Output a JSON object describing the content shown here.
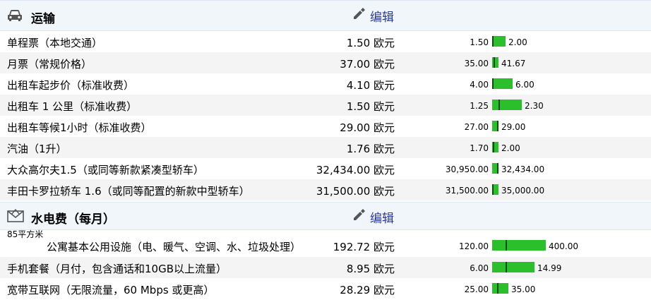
{
  "sections": [
    {
      "title": "运输",
      "icon": "car-icon",
      "edit_label": "编辑",
      "rows": [
        {
          "label": "单程票（本地交通）",
          "value": "1.50 欧元",
          "min": "1.50",
          "max": "2.00",
          "marker_pct": 0
        },
        {
          "label": "月票（常规价格）",
          "value": "37.00 欧元",
          "min": "35.00",
          "max": "41.67",
          "marker_pct": 30
        },
        {
          "label": "出租车起步价（标准收费）",
          "value": "4.10 欧元",
          "min": "4.00",
          "max": "6.00",
          "marker_pct": 5
        },
        {
          "label": "出租车 1 公里（标准收费）",
          "value": "1.50 欧元",
          "min": "1.25",
          "max": "2.30",
          "marker_pct": 24
        },
        {
          "label": "出租车等候1小时（标准收费）",
          "value": "29.00 欧元",
          "min": "27.00",
          "max": "29.00",
          "marker_pct": 100
        },
        {
          "label": "汽油（1升）",
          "value": "1.76 欧元",
          "min": "1.70",
          "max": "2.00",
          "marker_pct": 20
        },
        {
          "label": "大众高尔夫1.5（或同等新款紧凑型轿车）",
          "value": "32,434.00 欧元",
          "min": "30,950.00",
          "max": "32,434.00",
          "marker_pct": 100
        },
        {
          "label": "丰田卡罗拉轿车 1.6（或同等配置的新款中型轿车）",
          "value": "31,500.00 欧元",
          "min": "31,500.00",
          "max": "35,000.00",
          "marker_pct": 0
        }
      ]
    },
    {
      "title": "水电费（每月）",
      "icon": "mail-envelope-icon",
      "edit_label": "编辑",
      "note": "85平方米",
      "rows": [
        {
          "label": "公寓基本公用设施（电、暖气、空调、水、垃圾处理）",
          "value": "192.72 欧元",
          "min": "120.00",
          "max": "400.00",
          "marker_pct": 26
        },
        {
          "label": "手机套餐（月付，包含通话和10GB以上流量）",
          "value": "8.95 欧元",
          "min": "6.00",
          "max": "14.99",
          "marker_pct": 33
        },
        {
          "label": "宽带互联网（无限流量，60 Mbps 或更高）",
          "value": "28.29 欧元",
          "min": "25.00",
          "max": "35.00",
          "marker_pct": 33
        }
      ]
    }
  ],
  "colors": {
    "bar": "#2cbf2c",
    "marker": "#0b4f0b",
    "edit_link": "#2b39a3",
    "header_bg": "#f1f6fb"
  }
}
